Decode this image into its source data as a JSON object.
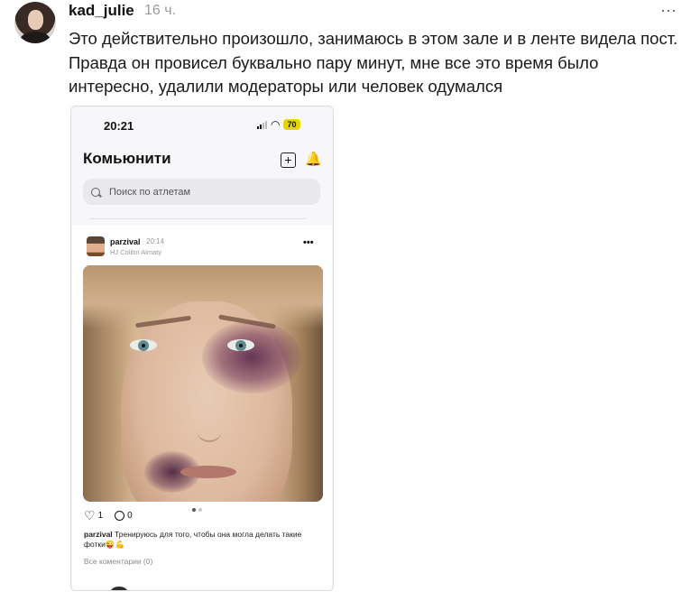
{
  "comment": {
    "author": "kad_julie",
    "time": "16 ч.",
    "more_icon": "⋯",
    "lines": [
      "Это действительно произошло, занимаюсь в этом зале и в ленте видела пост.",
      "Правда он провисел буквально пару минут, мне все это время было",
      "интересно, удалили модераторы или человек одумался"
    ]
  },
  "screenshot": {
    "status_time": "20:21",
    "battery": "70",
    "screen_title": "Комьюнити",
    "add_icon": "+",
    "bell_icon": "🔔",
    "search_placeholder": "Поиск по атлетам",
    "post": {
      "username": "parzival",
      "time": "20:14",
      "place": "HJ Colibri Almaty",
      "more_icon": "•••",
      "likes": "1",
      "comments": "0",
      "caption_user": "parzival",
      "caption_text": "Тренируюсь для того, чтобы она могла делать такие фотки😜💪",
      "all_comments": "Все коментарии (0)",
      "carousel_slides": 2,
      "carousel_active": 1
    }
  }
}
